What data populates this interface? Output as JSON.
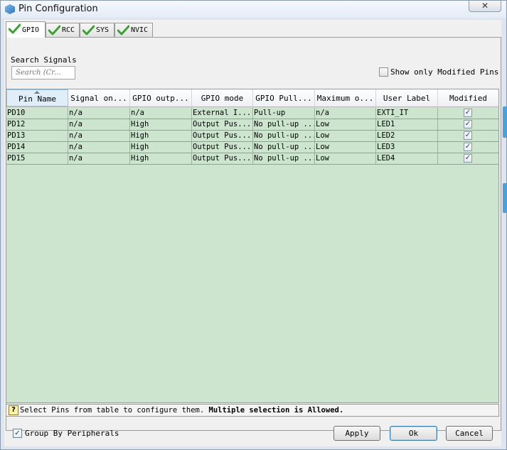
{
  "window": {
    "title": "Pin Configuration",
    "close_label": "✕"
  },
  "tabs": [
    {
      "label": "GPIO",
      "active": true,
      "icon": "green-check-icon"
    },
    {
      "label": "RCC",
      "active": false,
      "icon": "green-check-icon"
    },
    {
      "label": "SYS",
      "active": false,
      "icon": "green-check-icon"
    },
    {
      "label": "NVIC",
      "active": false,
      "icon": "green-check-icon"
    }
  ],
  "search": {
    "title": "Search Signals",
    "placeholder": "Search (Cr..."
  },
  "filter": {
    "show_modified_label": "Show only Modified Pins",
    "checked": false
  },
  "table": {
    "headers": [
      "Pin Name",
      "Signal on...",
      "GPIO outp...",
      "GPIO mode",
      "GPIO Pull...",
      "Maximum o...",
      "User Label",
      "Modified"
    ],
    "rows": [
      [
        "PD10",
        "n/a",
        "n/a",
        "External I...",
        "Pull-up",
        "n/a",
        "EXTI_IT",
        "✓"
      ],
      [
        "PD12",
        "n/a",
        "High",
        "Output Pus...",
        "No pull-up ...",
        "Low",
        "LED1",
        "✓"
      ],
      [
        "PD13",
        "n/a",
        "High",
        "Output Pus...",
        "No pull-up ...",
        "Low",
        "LED2",
        "✓"
      ],
      [
        "PD14",
        "n/a",
        "High",
        "Output Pus...",
        "No pull-up ...",
        "Low",
        "LED3",
        "✓"
      ],
      [
        "PD15",
        "n/a",
        "High",
        "Output Pus...",
        "No pull-up ...",
        "Low",
        "LED4",
        "✓"
      ]
    ],
    "row_color": "#cde5cf"
  },
  "status": {
    "icon_glyph": "?",
    "text": "Select Pins from table to configure them.",
    "bold_text": "Multiple selection is Allowed."
  },
  "footer": {
    "group_label": "Group By Peripherals",
    "group_checked": true,
    "check_glyph": "✓",
    "apply_label": "Apply",
    "ok_label": "Ok",
    "cancel_label": "Cancel"
  },
  "colors": {
    "accent": "#4aa0db",
    "check_green": "#3ca132"
  }
}
